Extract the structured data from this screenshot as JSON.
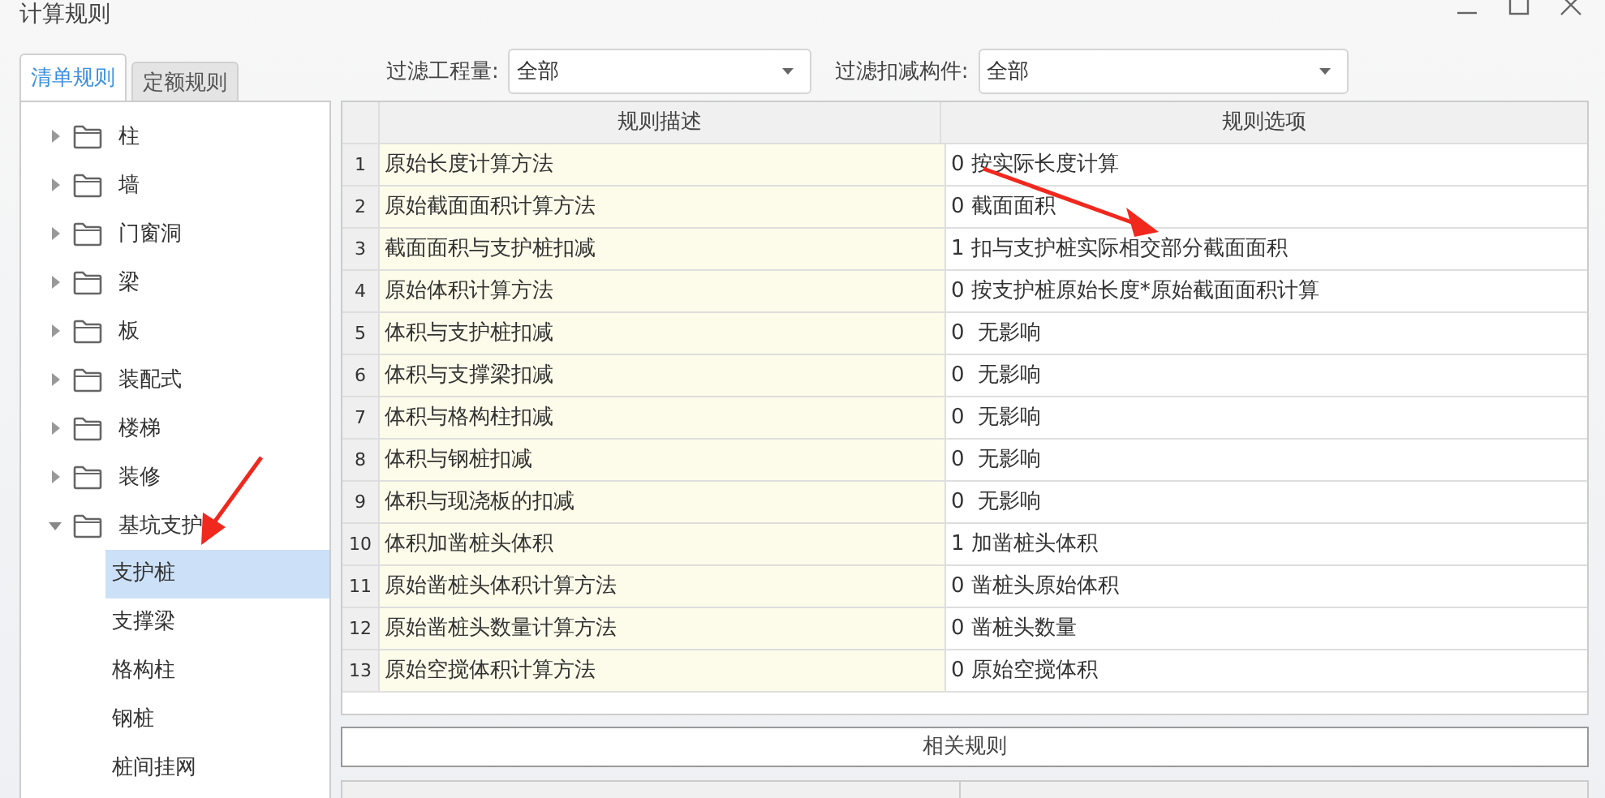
{
  "window": {
    "title": "计算规则"
  },
  "tabs": [
    {
      "label": "清单规则",
      "selected": true
    },
    {
      "label": "定额规则",
      "selected": false
    }
  ],
  "filters": [
    {
      "label": "过滤工程量:",
      "value": "全部"
    },
    {
      "label": "过滤扣减构件:",
      "value": "全部"
    }
  ],
  "tree": [
    {
      "label": "柱",
      "expanded": false
    },
    {
      "label": "墙",
      "expanded": false
    },
    {
      "label": "门窗洞",
      "expanded": false
    },
    {
      "label": "梁",
      "expanded": false
    },
    {
      "label": "板",
      "expanded": false
    },
    {
      "label": "装配式",
      "expanded": false
    },
    {
      "label": "楼梯",
      "expanded": false
    },
    {
      "label": "装修",
      "expanded": false
    },
    {
      "label": "基坑支护",
      "expanded": true,
      "children": [
        {
          "label": "支护桩",
          "selected": true
        },
        {
          "label": "支撑梁",
          "selected": false
        },
        {
          "label": "格构柱",
          "selected": false
        },
        {
          "label": "钢桩",
          "selected": false
        },
        {
          "label": "桩间挂网",
          "selected": false
        }
      ]
    }
  ],
  "table": {
    "columns": [
      "规则描述",
      "规则选项"
    ],
    "rows": [
      {
        "index": "1",
        "description": "原始长度计算方法",
        "option": "0 按实际长度计算"
      },
      {
        "index": "2",
        "description": "原始截面面积计算方法",
        "option": "0 截面面积"
      },
      {
        "index": "3",
        "description": "截面面积与支护桩扣减",
        "option": "1 扣与支护桩实际相交部分截面面积"
      },
      {
        "index": "4",
        "description": "原始体积计算方法",
        "option": "0 按支护桩原始长度*原始截面面积计算"
      },
      {
        "index": "5",
        "description": "体积与支护桩扣减",
        "option": "0  无影响"
      },
      {
        "index": "6",
        "description": "体积与支撑梁扣减",
        "option": "0  无影响"
      },
      {
        "index": "7",
        "description": "体积与格构柱扣减",
        "option": "0  无影响"
      },
      {
        "index": "8",
        "description": "体积与钢桩扣减",
        "option": "0  无影响"
      },
      {
        "index": "9",
        "description": "体积与现浇板的扣减",
        "option": "0  无影响"
      },
      {
        "index": "10",
        "description": "体积加凿桩头体积",
        "option": "1 加凿桩头体积"
      },
      {
        "index": "11",
        "description": "原始凿桩头体积计算方法",
        "option": "0 凿桩头原始体积"
      },
      {
        "index": "12",
        "description": "原始凿桩头数量计算方法",
        "option": "0 凿桩头数量"
      },
      {
        "index": "13",
        "description": "原始空搅体积计算方法",
        "option": "0 原始空搅体积"
      }
    ]
  },
  "related": {
    "title": "相关规则"
  }
}
